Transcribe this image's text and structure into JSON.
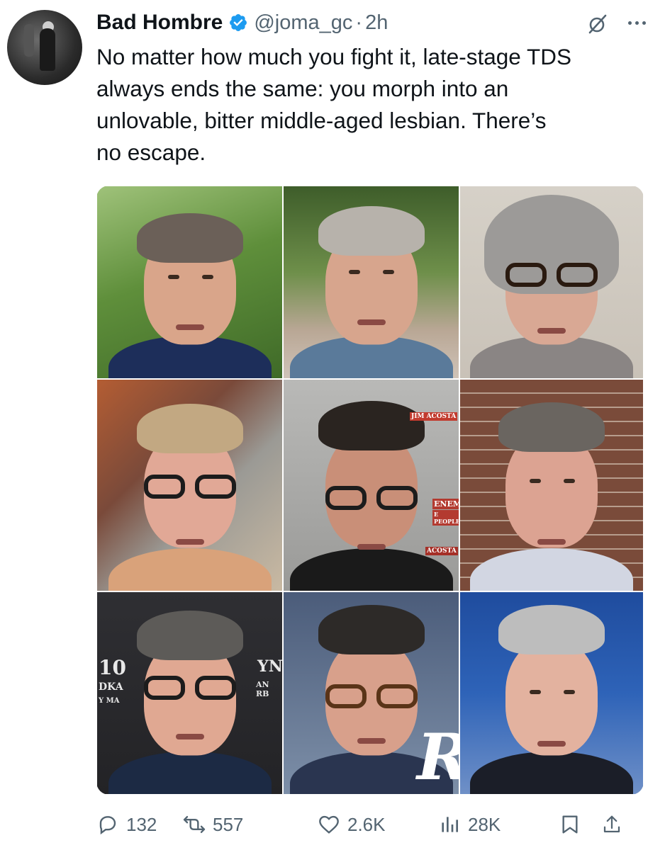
{
  "tweet": {
    "display_name": "Bad Hombre",
    "handle": "@joma_gc",
    "separator": "·",
    "time": "2h",
    "text": "No matter how much you fight it, late-stage TDS\nalways ends the same: you morph into an\nunlovable, bitter middle-aged lesbian. There’s\nno escape."
  },
  "media": {
    "tile_sign_texts": {
      "tile7_left": "10",
      "tile7_left_2": "DKA",
      "tile7_left_3": "Y MA",
      "tile7_right": "YN",
      "tile7_right_2": "AN RB",
      "tile8_letter": "R",
      "tile5_sign_1": "JIM ACOSTA",
      "tile5_sign_2": "ENEMY",
      "tile5_sign_3": "E PEOPLE",
      "tile5_sign_4": "ACOSTA"
    }
  },
  "actions": {
    "replies": "132",
    "reposts": "557",
    "likes": "2.6K",
    "views": "28K"
  },
  "colors": {
    "text": "#0f1419",
    "secondary": "#536471",
    "verified": "#1d9bf0"
  },
  "icons": [
    "verified-badge-icon",
    "grok-icon",
    "more-icon",
    "reply-icon",
    "repost-icon",
    "like-icon",
    "views-icon",
    "bookmark-icon",
    "share-icon"
  ]
}
